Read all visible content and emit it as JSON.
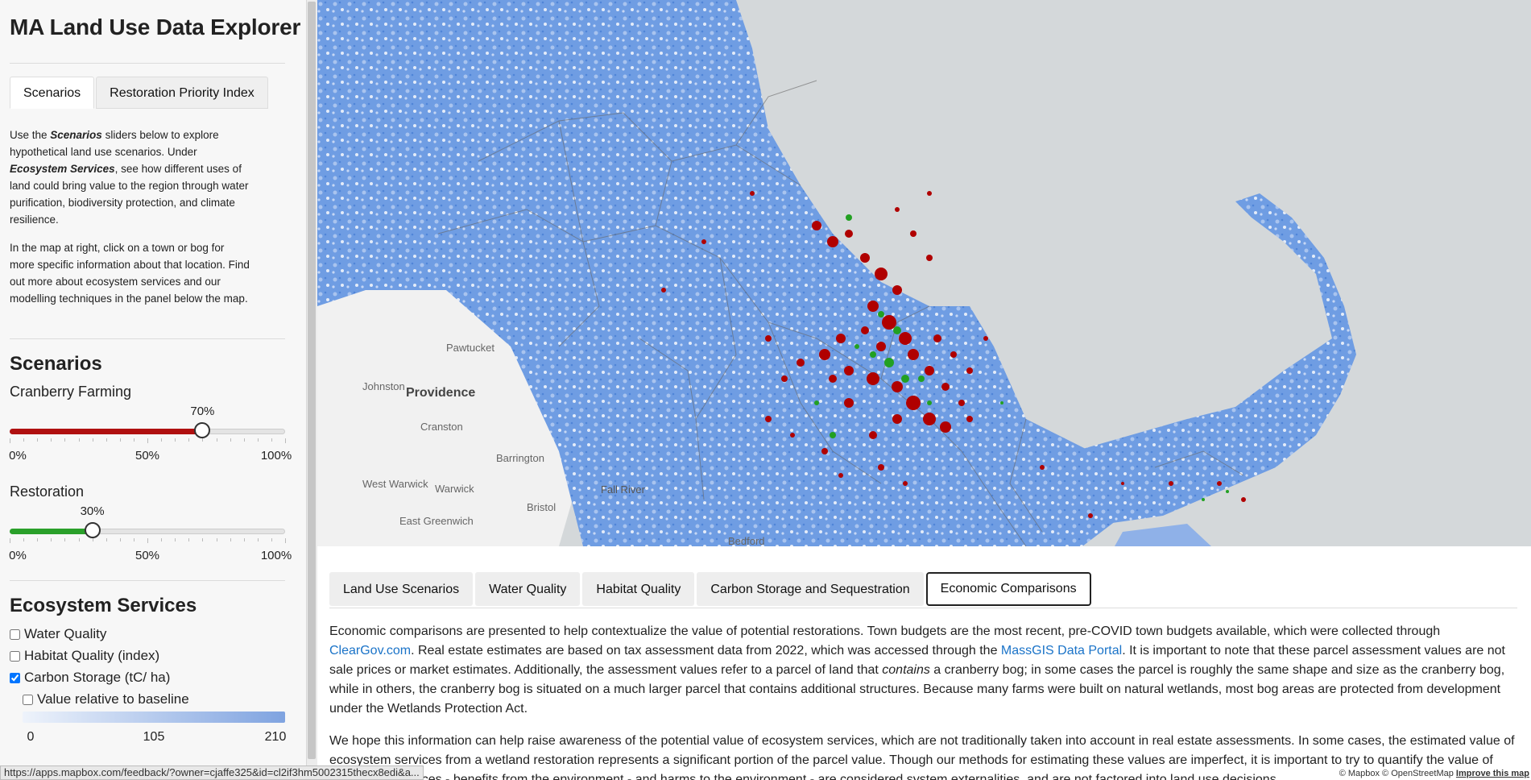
{
  "app": {
    "title": "MA Land Use Data Explorer"
  },
  "sidebar": {
    "tabs": [
      {
        "label": "Scenarios",
        "active": true
      },
      {
        "label": "Restoration Priority Index",
        "active": false
      }
    ],
    "intro_p1": "Use the Scenarios sliders below to explore hypothetical land use scenarios. Under Ecosystem Services, see how different uses of land could bring value to the region through water purification, biodiversity protection, and climate resilience.",
    "intro_p2": "In the map at right, click on a town or bog for more specific information about that location. Find out more about ecosystem services and our modelling techniques in the panel below the map.",
    "scenarios": {
      "heading": "Scenarios",
      "cranberry": {
        "label": "Cranberry Farming",
        "value_label": "70%",
        "value": 70,
        "color": "#b01010",
        "ticks": [
          "0%",
          "50%",
          "100%"
        ]
      },
      "restoration": {
        "label": "Restoration",
        "value_label": "30%",
        "value": 30,
        "color": "#2aa02a",
        "ticks": [
          "0%",
          "50%",
          "100%"
        ]
      }
    },
    "ecosystem": {
      "heading": "Ecosystem Services",
      "options": [
        {
          "label": "Water Quality",
          "checked": false
        },
        {
          "label": "Habitat Quality (index)",
          "checked": false
        },
        {
          "label": "Carbon Storage (tC/ ha)",
          "checked": true
        }
      ],
      "relative": {
        "label": "Value relative to baseline",
        "checked": false
      },
      "legend": {
        "min": "0",
        "mid": "105",
        "max": "210",
        "color_low": "#eef3fb",
        "color_high": "#7fa3e0"
      }
    }
  },
  "status_url": "https://apps.mapbox.com/feedback/?owner=cjaffe325&id=cl2if3hm5002315thecx8edi&a...",
  "map": {
    "labels": [
      "Pawtucket",
      "Providence",
      "Johnston",
      "Cranston",
      "West Warwick",
      "Warwick",
      "Bristol",
      "East Greenwich",
      "Fall River",
      "Barrington",
      "Bedford"
    ],
    "attribution": "© Mapbox © OpenStreetMap",
    "improve": "Improve this map",
    "colors": {
      "water": "#d4d8da",
      "land": "#f1f1f1",
      "carbon": "#5b8fdc",
      "cranberry": "#b00000",
      "restoration": "#22a022"
    }
  },
  "panel": {
    "tabs": [
      {
        "label": "Land Use Scenarios",
        "active": false
      },
      {
        "label": "Water Quality",
        "active": false
      },
      {
        "label": "Habitat Quality",
        "active": false
      },
      {
        "label": "Carbon Storage and Sequestration",
        "active": false
      },
      {
        "label": "Economic Comparisons",
        "active": true
      }
    ],
    "p1_a": "Economic comparisons are presented to help contextualize the value of potential restorations. Town budgets are the most recent, pre-COVID town budgets available, which were collected through ",
    "p1_link1": "ClearGov.com",
    "p1_b": ". Real estate estimates are based on tax assessment data from 2022, which was accessed through the ",
    "p1_link2": "MassGIS Data Portal",
    "p1_c": ". It is important to note that these parcel assessment values are not sale prices or market estimates. Additionally, the assessment values refer to a parcel of land that ",
    "p1_em": "contains",
    "p1_d": " a cranberry bog; in some cases the parcel is roughly the same shape and size as the cranberry bog, while in others, the cranberry bog is situated on a much larger parcel that contains additional structures. Because many farms were built on natural wetlands, most bog areas are protected from development under the Wetlands Protection Act.",
    "p2": "We hope this information can help raise awareness of the potential value of ecosystem services, which are not traditionally taken into account in real estate assessments. In some cases, the estimated value of ecosystem services from a wetland restoration represents a significant portion of the parcel value. Though our methods for estimating these values are imperfect, it is important to try to quantify the value of ecosystem services - benefits from the environment - and harms to the environment - are considered system externalities, and are not factored into land use decisions."
  }
}
